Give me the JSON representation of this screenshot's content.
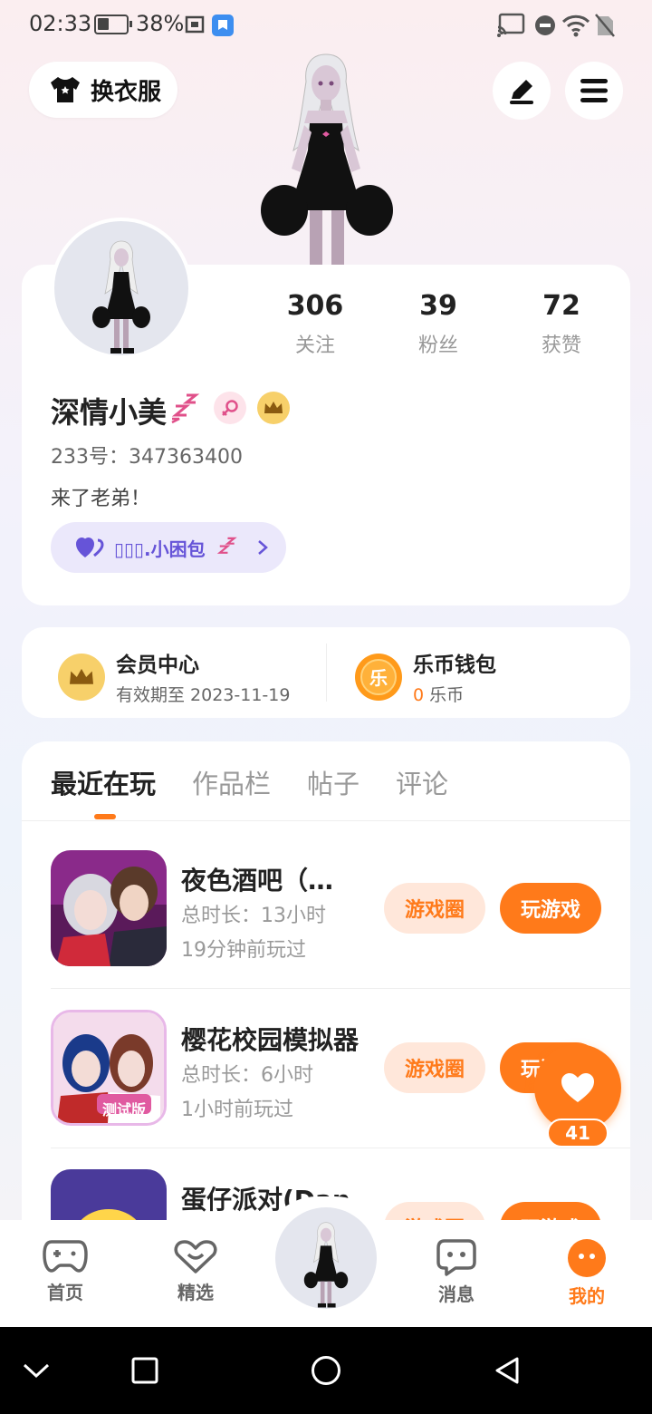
{
  "status_bar": {
    "time": "02:33",
    "battery_pct": "38%"
  },
  "header": {
    "outfit_label": "换衣服"
  },
  "profile": {
    "username": "深情小美",
    "uid": "233号：347363400",
    "bio": "来了老弟！",
    "cp_tag": "▯▯▯.小困包",
    "stats": [
      {
        "value": "306",
        "label": "关注"
      },
      {
        "value": "39",
        "label": "粉丝"
      },
      {
        "value": "72",
        "label": "获赞"
      }
    ]
  },
  "vip": {
    "member_title": "会员中心",
    "member_sub": "有效期至 2023-11-19",
    "wallet_title": "乐币钱包",
    "wallet_amount": "0",
    "wallet_unit": "乐币",
    "coin_glyph": "乐"
  },
  "tabs": [
    "最近在玩",
    "作品栏",
    "帖子",
    "评论"
  ],
  "games": [
    {
      "name": "夜色酒吧（测试服）",
      "duration": "总时长：13小时",
      "last_played": "19分钟前玩过",
      "circle_label": "游戏圈",
      "play_label": "玩游戏"
    },
    {
      "name": "樱花校园模拟器",
      "duration": "总时长：6小时",
      "last_played": "1小时前玩过",
      "circle_label": "游戏圈",
      "play_label": "玩游戏",
      "thumb_text": "测试版"
    },
    {
      "name": "蛋仔派对(Dan",
      "duration": "",
      "last_played": "",
      "circle_label": "游戏圈",
      "play_label": "玩游戏"
    }
  ],
  "like": {
    "count": "41"
  },
  "bottom_nav": [
    {
      "label": "首页",
      "icon": "gamepad-icon"
    },
    {
      "label": "精选",
      "icon": "heart-chat-icon"
    },
    {
      "label": "消息",
      "icon": "message-icon"
    },
    {
      "label": "我的",
      "icon": "profile-icon"
    }
  ],
  "colors": {
    "accent": "#ff7a1a",
    "purple": "#6654d8"
  }
}
